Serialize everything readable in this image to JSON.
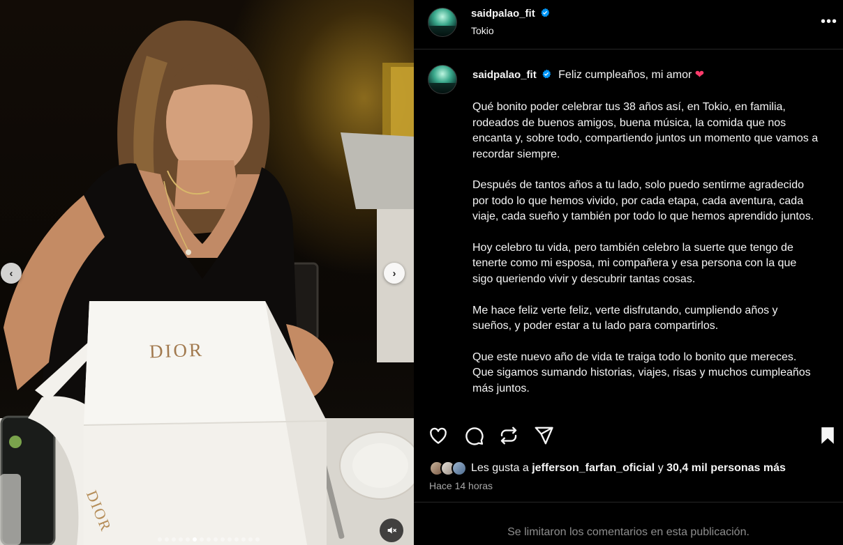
{
  "media": {
    "box_brand": "DIOR",
    "ribbon_brand": "DIOR",
    "prev_arrow": "‹",
    "next_arrow": "›",
    "carousel": {
      "total": 15,
      "active_index": 5
    }
  },
  "post": {
    "username": "saidpalao_fit",
    "location": "Tokio",
    "more_label": "•••",
    "caption_intro": "Feliz cumpleaños, mi amor",
    "caption_emoji": "❤",
    "caption_paragraphs": [
      "Qué bonito poder celebrar tus 38 años así, en Tokio, en familia, rodeados de buenos amigos, buena música, la comida que nos encanta y, sobre todo, compartiendo juntos un momento que vamos a recordar siempre.",
      "Después de tantos años a tu lado, solo puedo sentirme agradecido por todo lo que hemos vivido, por cada etapa, cada aventura, cada viaje, cada sueño y también por todo lo que hemos aprendido juntos.",
      "Hoy celebro tu vida, pero también celebro la suerte que tengo de tenerte como mi esposa, mi compañera y esa persona con la que sigo queriendo vivir y descubrir tantas cosas.",
      "Me hace feliz verte feliz, verte disfrutando, cumpliendo años y sueños, y poder estar a tu lado para compartirlos.",
      "Que este nuevo año de vida te traiga todo lo bonito que mereces. Que sigamos sumando historias, viajes, risas y muchos cumpleaños más juntos."
    ],
    "likes": {
      "prefix": "Les gusta a",
      "user": "jefferson_farfan_oficial",
      "connector": "y",
      "others": "30,4 mil personas más"
    },
    "time_ago": "Hace 14 horas",
    "comments_notice": "Se limitaron los comentarios en esta publicación."
  },
  "colors": {
    "background": "#000000",
    "text": "#f5f5f5",
    "muted": "#a8a8a8",
    "verified": "#0095f6",
    "divider": "#262626"
  }
}
